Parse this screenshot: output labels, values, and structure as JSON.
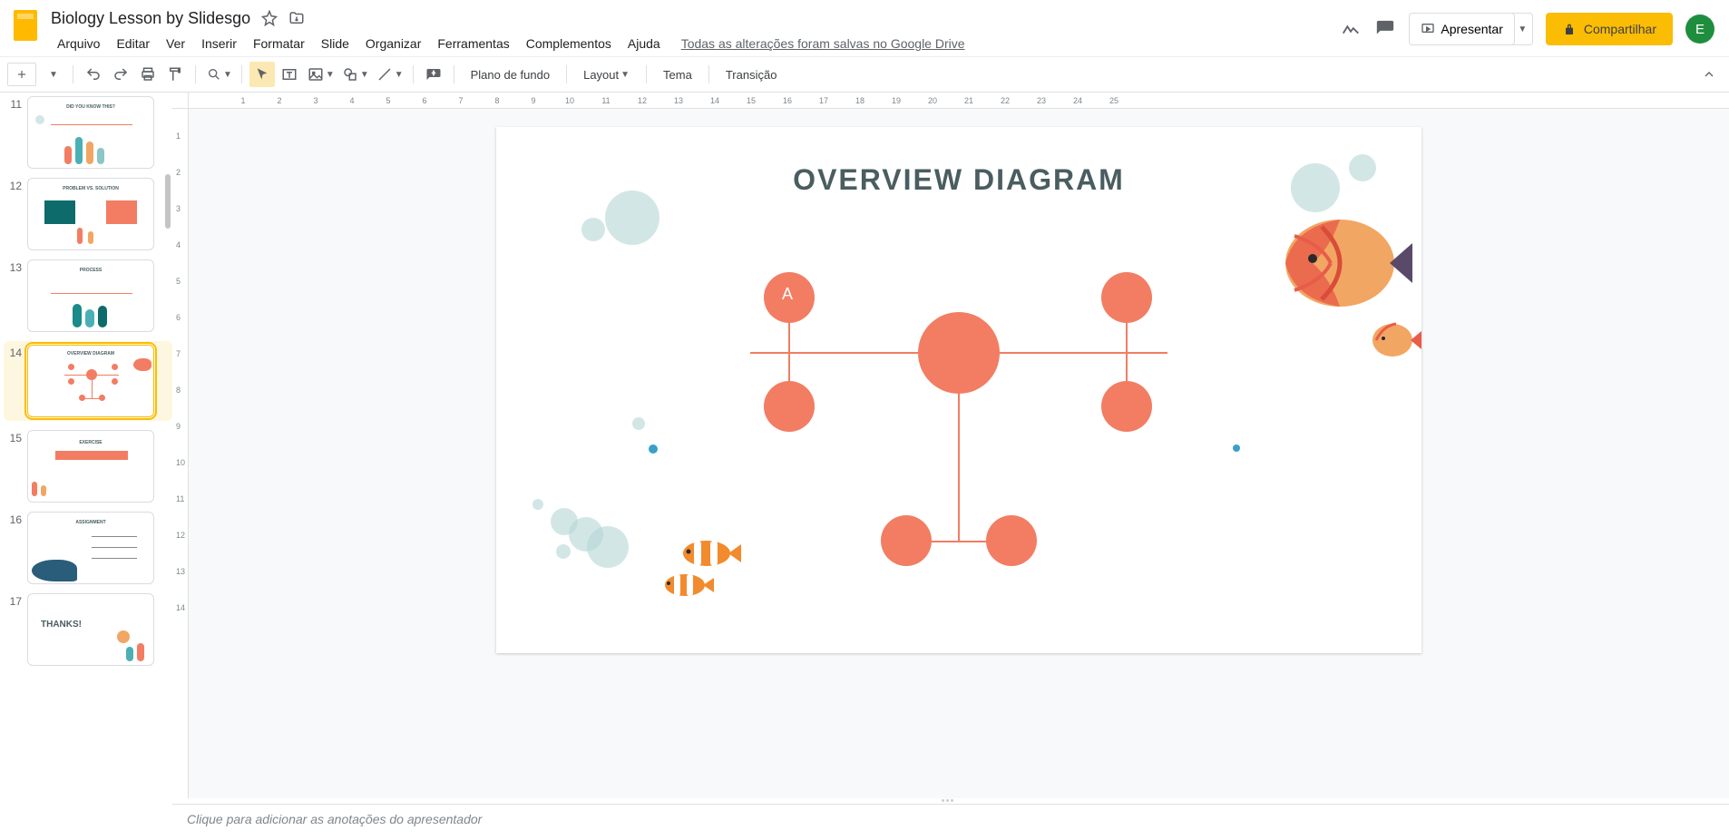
{
  "doc": {
    "title": "Biology Lesson by Slidesgo"
  },
  "menu": {
    "items": [
      "Arquivo",
      "Editar",
      "Ver",
      "Inserir",
      "Formatar",
      "Slide",
      "Organizar",
      "Ferramentas",
      "Complementos",
      "Ajuda"
    ],
    "save_state": "Todas as alterações foram salvas no Google Drive"
  },
  "header_actions": {
    "present": "Apresentar",
    "share": "Compartilhar",
    "avatar_initial": "E"
  },
  "toolbar": {
    "background": "Plano de fundo",
    "layout": "Layout",
    "theme": "Tema",
    "transition": "Transição"
  },
  "filmstrip": {
    "thumbs": [
      {
        "num": "11",
        "caption": "DID YOU KNOW THIS?"
      },
      {
        "num": "12",
        "caption": "PROBLEM VS. SOLUTION"
      },
      {
        "num": "13",
        "caption": "PROCESS"
      },
      {
        "num": "14",
        "caption": "OVERVIEW DIAGRAM",
        "active": true
      },
      {
        "num": "15",
        "caption": "EXERCISE"
      },
      {
        "num": "16",
        "caption": "ASSIGNMENT"
      },
      {
        "num": "17",
        "caption": "THANKS!"
      }
    ]
  },
  "ruler": {
    "h": [
      "1",
      "2",
      "3",
      "4",
      "5",
      "6",
      "7",
      "8",
      "9",
      "10",
      "11",
      "12",
      "13",
      "14",
      "15",
      "16",
      "17",
      "18",
      "19",
      "20",
      "21",
      "22",
      "23",
      "24",
      "25"
    ],
    "v": [
      "1",
      "2",
      "3",
      "4",
      "5",
      "6",
      "7",
      "8",
      "9",
      "10",
      "11",
      "12",
      "13",
      "14"
    ]
  },
  "slide": {
    "title": "OVERVIEW DIAGRAM",
    "node_a_label": "A"
  },
  "notes": {
    "placeholder": "Clique para adicionar as anotações do apresentador"
  }
}
